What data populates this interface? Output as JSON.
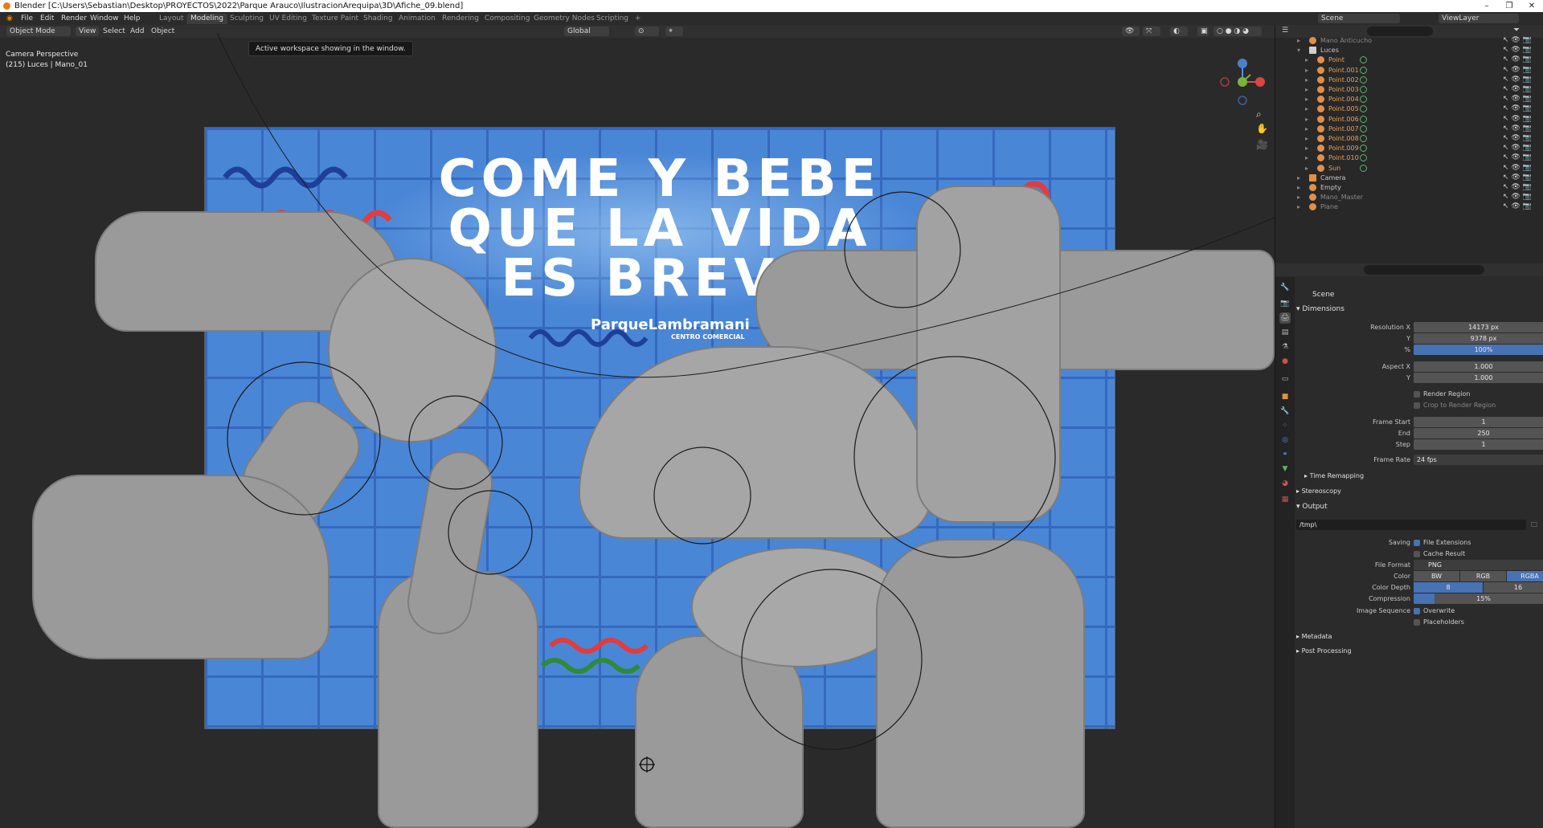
{
  "window": {
    "title": "Blender [C:\\Users\\Sebastian\\Desktop\\PROYECTOS\\2022\\Parque Arauco\\IlustracionArequipa\\3D\\Afiche_09.blend]",
    "minimize": "–",
    "maximize": "❐",
    "close": "✕"
  },
  "menubar": [
    "File",
    "Edit",
    "Render",
    "Window",
    "Help"
  ],
  "workspaces": [
    "Layout",
    "Modeling",
    "Sculpting",
    "UV Editing",
    "Texture Paint",
    "Shading",
    "Animation",
    "Rendering",
    "Compositing",
    "Geometry Nodes",
    "Scripting"
  ],
  "workspace_add": "+",
  "scene_selector": {
    "scene": "Scene",
    "view_layer": "ViewLayer"
  },
  "viewport_header": {
    "mode": "Object Mode",
    "menus": [
      "View",
      "Select",
      "Add",
      "Object"
    ],
    "orientation": "Global"
  },
  "tooltip": "Active workspace showing in the window.",
  "camera_label": {
    "line1": "Camera Perspective",
    "line2": "(215) Luces | Mano_01"
  },
  "poster": {
    "headline": [
      "COME Y BEBE",
      "QUE LA VIDA",
      "ES BREVE"
    ],
    "brand": "ParqueLambramani",
    "brand_sub": "CENTRO COMERCIAL"
  },
  "outliner": {
    "rows": [
      {
        "name": "Mano Anticucho",
        "kind": "object"
      },
      {
        "name": "Luces",
        "kind": "collection"
      },
      {
        "name": "Point",
        "kind": "light"
      },
      {
        "name": "Point.001",
        "kind": "light"
      },
      {
        "name": "Point.002",
        "kind": "light"
      },
      {
        "name": "Point.003",
        "kind": "light"
      },
      {
        "name": "Point.004",
        "kind": "light"
      },
      {
        "name": "Point.005",
        "kind": "light"
      },
      {
        "name": "Point.006",
        "kind": "light"
      },
      {
        "name": "Point.007",
        "kind": "light"
      },
      {
        "name": "Point.008",
        "kind": "light"
      },
      {
        "name": "Point.009",
        "kind": "light"
      },
      {
        "name": "Point.010",
        "kind": "light"
      },
      {
        "name": "Sun",
        "kind": "light"
      },
      {
        "name": "Camera",
        "kind": "camera"
      },
      {
        "name": "Empty",
        "kind": "empty"
      },
      {
        "name": "Mano_Master",
        "kind": "object"
      },
      {
        "name": "Plane",
        "kind": "object"
      }
    ]
  },
  "properties": {
    "context": "Scene",
    "dimensions": {
      "title": "Dimensions",
      "resolution_x_label": "Resolution X",
      "resolution_x": "14173 px",
      "y_label": "Y",
      "resolution_y": "9378 px",
      "pct_label": "%",
      "percent": "100%",
      "aspect_x_label": "Aspect X",
      "aspect_x": "1.000",
      "aspect_y_label": "Y",
      "aspect_y": "1.000",
      "render_region": "Render Region",
      "crop_region": "Crop to Render Region",
      "frame_start_label": "Frame Start",
      "frame_start": "1",
      "end_label": "End",
      "frame_end": "250",
      "step_label": "Step",
      "frame_step": "1",
      "frame_rate_label": "Frame Rate",
      "frame_rate": "24 fps",
      "time_remapping": "Time Remapping"
    },
    "stereoscopy": "Stereoscopy",
    "output": {
      "title": "Output",
      "path": "/tmp\\",
      "saving_label": "Saving",
      "file_extensions": "File Extensions",
      "cache_result": "Cache Result",
      "file_format_label": "File Format",
      "file_format": "PNG",
      "color_label": "Color",
      "color_options": [
        "BW",
        "RGB",
        "RGBA"
      ],
      "color_depth_label": "Color Depth",
      "color_depth_options": [
        "8",
        "16"
      ],
      "compression_label": "Compression",
      "compression": "15%",
      "image_sequence_label": "Image Sequence",
      "overwrite": "Overwrite",
      "placeholders": "Placeholders"
    },
    "metadata": "Metadata",
    "post_processing": "Post Processing"
  }
}
